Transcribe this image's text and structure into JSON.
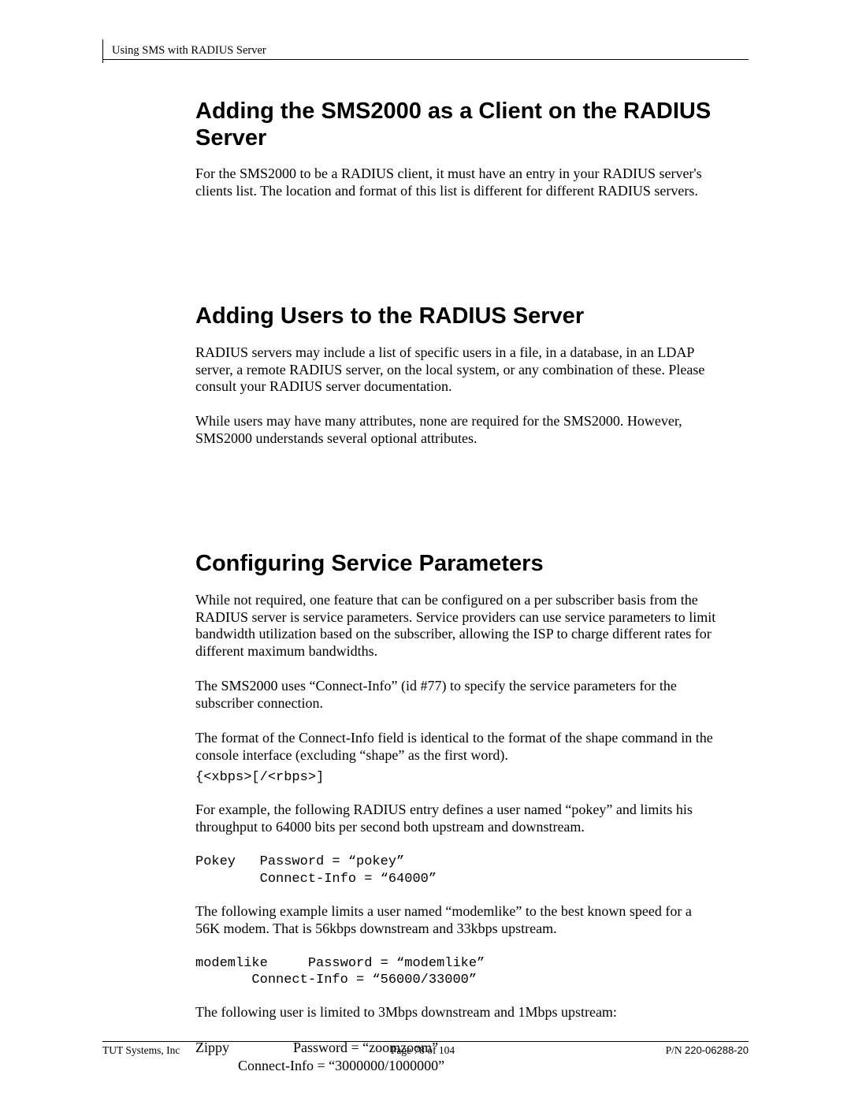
{
  "header": {
    "running": "Using SMS with RADIUS Server"
  },
  "sections": {
    "s1": {
      "title": "Adding the SMS2000 as a Client on the RADIUS Server",
      "p1": "For the SMS2000 to be a RADIUS client, it must have an entry in your RADIUS server's clients list. The location and format of this list is different for different RADIUS servers."
    },
    "s2": {
      "title": "Adding Users to the RADIUS Server",
      "p1": "RADIUS servers may include a list of specific users in a file, in a database, in an LDAP server, a remote RADIUS server, on the local system, or any combination of these. Please consult your RADIUS server documentation.",
      "p2": "While users may have many attributes, none are required for the SMS2000.  However, SMS2000 understands several optional attributes."
    },
    "s3": {
      "title": "Configuring Service Parameters",
      "p1": "While not required, one feature that can be configured on a per subscriber basis from the RADIUS server is service parameters. Service providers can use service parameters to limit bandwidth utilization based on the subscriber, allowing the ISP to charge different rates for different maximum bandwidths.",
      "p2": "The SMS2000 uses “Connect-Info” (id #77) to specify the service parameters for the subscriber connection.",
      "p3": "The format of the Connect-Info field is identical to the format of the shape command in the console interface (excluding “shape” as the first word).",
      "syntax": "{<xbps>[/<rbps>]",
      "p4": "For example, the following RADIUS entry defines a user named “pokey” and limits his throughput to 64000 bits per second both upstream and downstream.",
      "code1": "Pokey   Password = “pokey”\n        Connect-Info = “64000”",
      "p5": "The following example limits a user named “modemlike” to the best known speed for a 56K modem. That is 56kbps downstream and 33kbps upstream.",
      "code2": "modemlike     Password = “modemlike”\n       Connect-Info = “56000/33000”",
      "p6": "The following user is limited to 3Mbps downstream and 1Mbps upstream:",
      "code3": "Zippy                  Password = “zoomzoom”\n            Connect-Info = “3000000/1000000”"
    }
  },
  "footer": {
    "company": "TUT Systems, Inc",
    "page": "Page 78 of 104",
    "pn_label": "P/N ",
    "pn": "220-06288-20"
  }
}
